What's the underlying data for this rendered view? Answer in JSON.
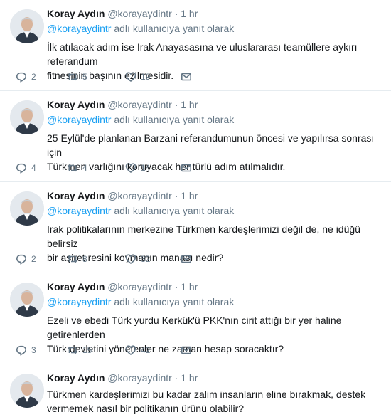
{
  "tweets": [
    {
      "name": "Koray Aydın",
      "handle": "@korayaydintr",
      "separator": "·",
      "time": "1 hr",
      "reply_mention": "@korayaydintr",
      "reply_suffix": " adlı kullanıcıya yanıt olarak",
      "text": "İlk atılacak adım ise Irak Anayasasına ve uluslararası teamüllere aykırı referandum\nfitnesinin başının ezilmesidir.",
      "replies": "2",
      "retweets": "5",
      "likes": "19"
    },
    {
      "name": "Koray Aydın",
      "handle": "@korayaydintr",
      "separator": "·",
      "time": "1 hr",
      "reply_mention": "@korayaydintr",
      "reply_suffix": " adlı kullanıcıya yanıt olarak",
      "text": "25 Eylül'de planlanan Barzani referandumunun öncesi ve yapılırsa sonrası için\nTürkmen varlığını koruyacak her türlü adım atılmalıdır.",
      "replies": "4",
      "retweets": "4",
      "likes": "14"
    },
    {
      "name": "Koray Aydın",
      "handle": "@korayaydintr",
      "separator": "·",
      "time": "1 hr",
      "reply_mention": "@korayaydintr",
      "reply_suffix": " adlı kullanıcıya yanıt olarak",
      "text": "Irak politikalarının merkezine Türkmen kardeşlerimizi değil de, ne idüğü belirsiz\nbir aşiret resini koymanın manası nedir?",
      "replies": "2",
      "retweets": "8",
      "likes": "32"
    },
    {
      "name": "Koray Aydın",
      "handle": "@korayaydintr",
      "separator": "·",
      "time": "1 hr",
      "reply_mention": "@korayaydintr",
      "reply_suffix": " adlı kullanıcıya yanıt olarak",
      "text": "Ezeli ve ebedi Türk yurdu Kerkük'ü PKK'nın cirit attığı bir yer haline getirenlerden\nTürk devletini yönetenler ne zaman hesap soracaktır?",
      "replies": "3",
      "retweets": "15",
      "likes": "42"
    },
    {
      "name": "Koray Aydın",
      "handle": "@korayaydintr",
      "separator": "·",
      "time": "1 hr",
      "text": "Türkmen kardeşlerimizi bu kadar zalim insanların eline bırakmak, destek\nvermemek nasıl bir politikanın ürünü olabilir?"
    }
  ],
  "icons": {
    "reply": "reply-icon",
    "retweet": "retweet-icon",
    "like": "heart-icon",
    "message": "envelope-icon"
  }
}
